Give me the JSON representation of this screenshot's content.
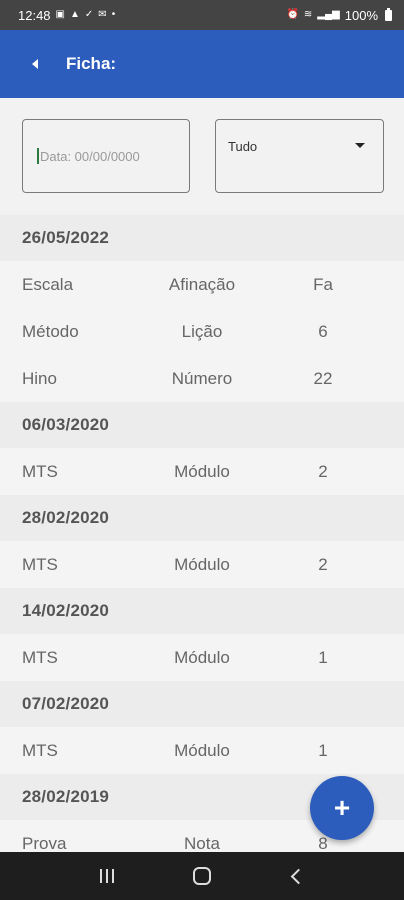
{
  "status_bar": {
    "time": "12:48",
    "battery": "100%",
    "left_icons": [
      "image-icon",
      "alert-icon",
      "check-icon",
      "mail-icon",
      "dot-icon"
    ],
    "right_icons": [
      "alarm-icon",
      "wifi-icon",
      "volte-icon",
      "signal-icon",
      "battery-icon"
    ]
  },
  "app_bar": {
    "title": "Ficha:",
    "color": "#2c5cbc"
  },
  "filters": {
    "date_placeholder": "Data: 00/00/0000",
    "date_value": "",
    "select_value": "Tudo"
  },
  "groups": [
    {
      "date": "26/05/2022",
      "rows": [
        [
          "Escala",
          "Afinação",
          "Fa"
        ],
        [
          "Método",
          "Lição",
          "6"
        ],
        [
          "Hino",
          "Número",
          "22"
        ]
      ]
    },
    {
      "date": "06/03/2020",
      "rows": [
        [
          "MTS",
          "Módulo",
          "2"
        ]
      ]
    },
    {
      "date": "28/02/2020",
      "rows": [
        [
          "MTS",
          "Módulo",
          "2"
        ]
      ]
    },
    {
      "date": "14/02/2020",
      "rows": [
        [
          "MTS",
          "Módulo",
          "1"
        ]
      ]
    },
    {
      "date": "07/02/2020",
      "rows": [
        [
          "MTS",
          "Módulo",
          "1"
        ]
      ]
    },
    {
      "date": "28/02/2019",
      "rows": [
        [
          "Prova",
          "Nota",
          "8"
        ]
      ]
    }
  ],
  "fab": {
    "label": "+",
    "icon": "plus-icon"
  },
  "nav_bar": {
    "buttons": [
      "recent-apps-icon",
      "home-icon",
      "back-icon"
    ]
  }
}
